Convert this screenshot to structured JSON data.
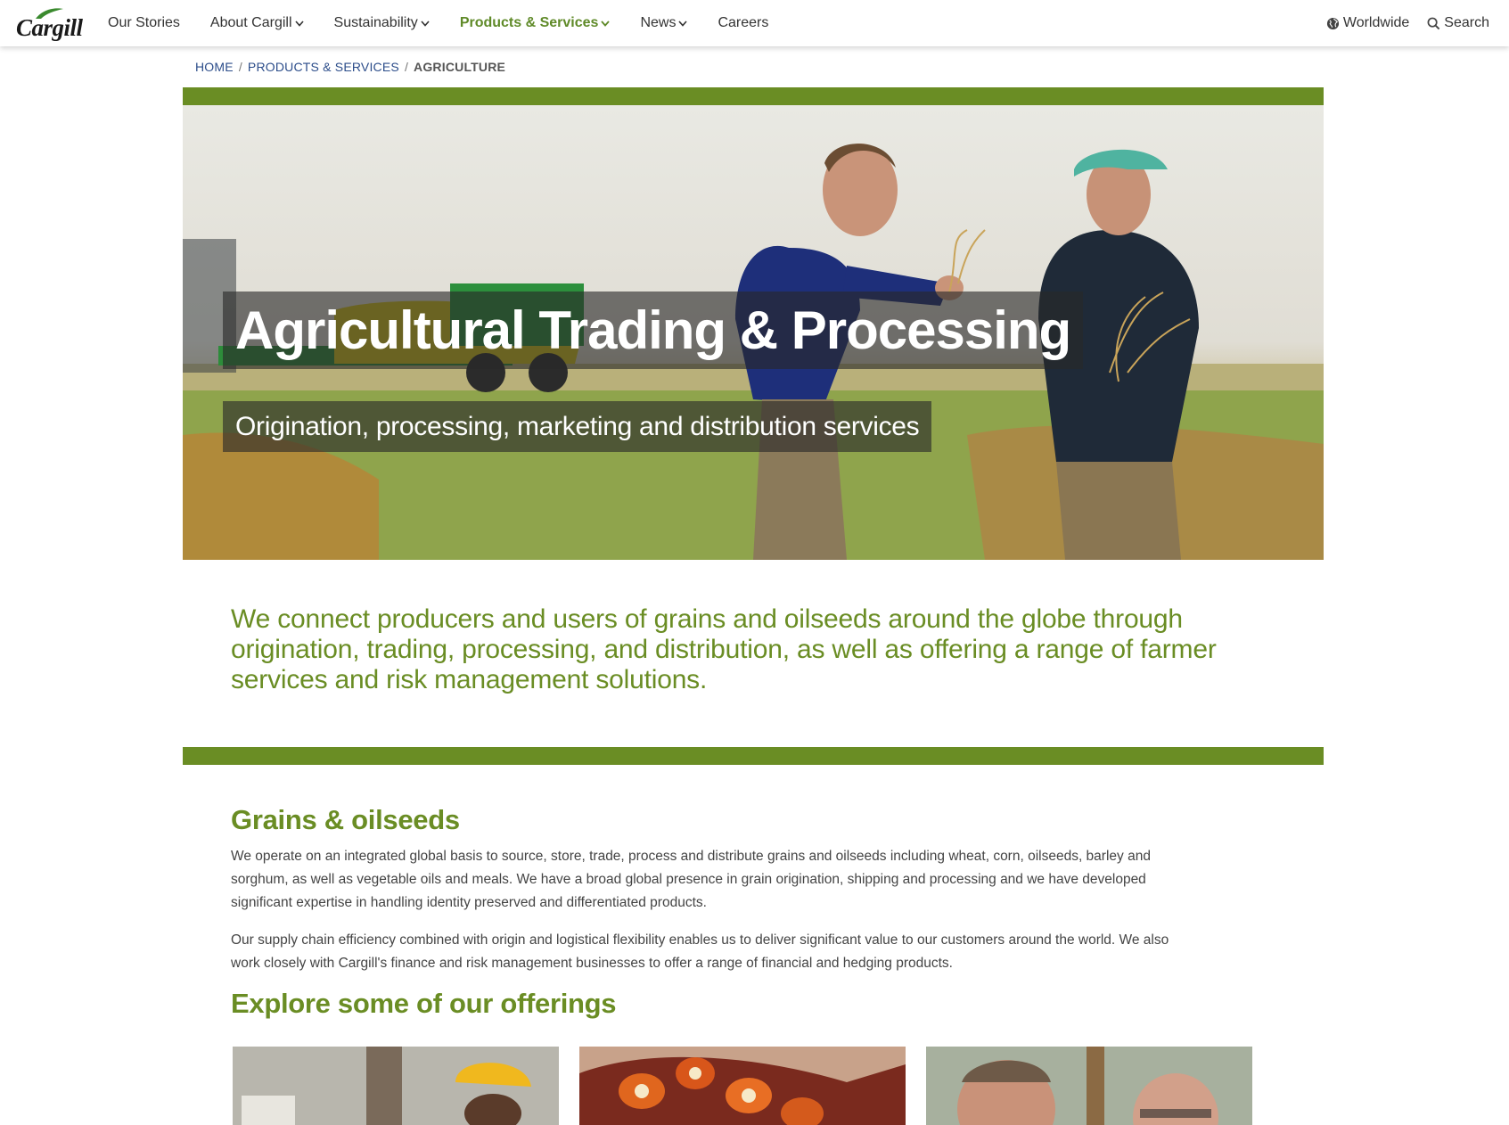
{
  "header": {
    "logo_text": "Cargill",
    "nav": [
      {
        "label": "Our Stories",
        "dropdown": false,
        "active": false
      },
      {
        "label": "About Cargill",
        "dropdown": true,
        "active": false
      },
      {
        "label": "Sustainability",
        "dropdown": true,
        "active": false
      },
      {
        "label": "Products & Services",
        "dropdown": true,
        "active": true
      },
      {
        "label": "News",
        "dropdown": true,
        "active": false
      },
      {
        "label": "Careers",
        "dropdown": false,
        "active": false
      }
    ],
    "worldwide_label": "Worldwide",
    "search_label": "Search"
  },
  "breadcrumb": {
    "home": "HOME",
    "products": "PRODUCTS & SERVICES",
    "current": "AGRICULTURE",
    "separator": "/"
  },
  "hero": {
    "title": "Agricultural Trading & Processing",
    "subtitle": "Origination, processing, marketing and distribution services"
  },
  "intro": "We connect producers and users of grains and oilseeds around the globe through origination, trading, processing, and distribution, as well as offering a range of farmer services and risk management solutions.",
  "section": {
    "heading": "Grains & oilseeds",
    "paragraph1": "We operate on an integrated global basis to source, store, trade, process and distribute grains and oilseeds including wheat, corn, oilseeds, barley and sorghum, as well as vegetable oils and meals. We have a broad global presence in grain origination, shipping and processing and we have developed significant expertise in handling identity preserved and differentiated products.",
    "paragraph2": "Our supply chain efficiency combined with origin and logistical flexibility enables us to deliver significant value to our customers around the world. We also work closely with Cargill's finance and risk management businesses to offer a range of financial and hedging products.",
    "explore_heading": "Explore some of our offerings"
  },
  "colors": {
    "brand_green": "#6a8d24",
    "nav_active": "#5f8a28",
    "link_blue": "#2c4d8a"
  }
}
